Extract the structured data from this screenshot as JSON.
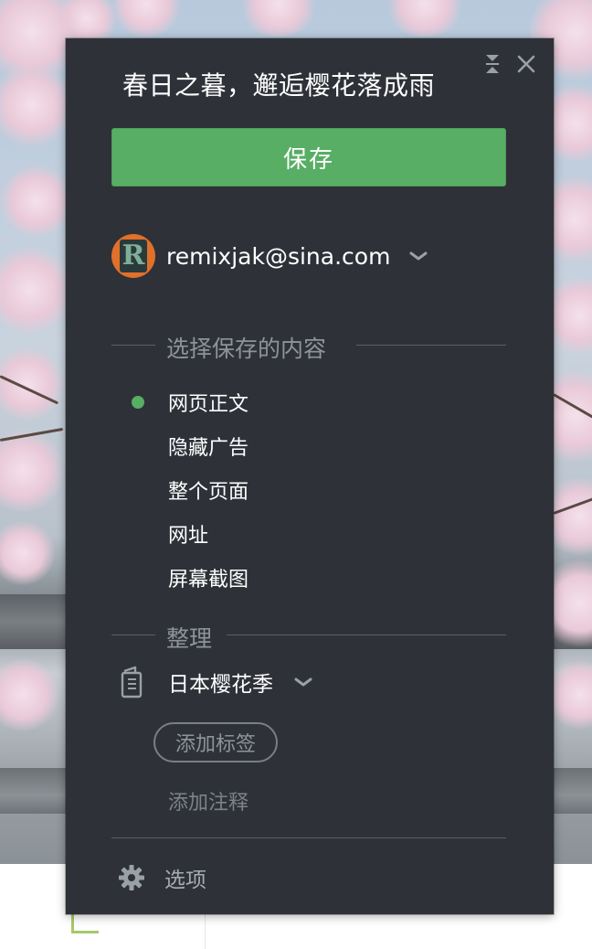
{
  "clipper": {
    "title": "春日之暮，邂逅樱花落成雨",
    "save_label": "保存",
    "account": {
      "email": "remixjak@sina.com",
      "avatar_letter": "R"
    },
    "content_section": {
      "heading": "选择保存的内容",
      "options": [
        {
          "label": "网页正文",
          "selected": true
        },
        {
          "label": "隐藏广告",
          "selected": false
        },
        {
          "label": "整个页面",
          "selected": false
        },
        {
          "label": "网址",
          "selected": false
        },
        {
          "label": "屏幕截图",
          "selected": false
        }
      ]
    },
    "organize_section": {
      "heading": "整理",
      "notebook": "日本樱花季",
      "add_tag": "添加标签",
      "add_note_placeholder": "添加注释"
    },
    "settings_label": "选项"
  },
  "colors": {
    "panel_bg": "#2e3138",
    "accent_green": "#58ae64",
    "muted_text": "#8e939b"
  },
  "icons": [
    "collapse-icon",
    "close-icon",
    "chevron-down-icon",
    "notebook-icon",
    "gear-icon"
  ]
}
